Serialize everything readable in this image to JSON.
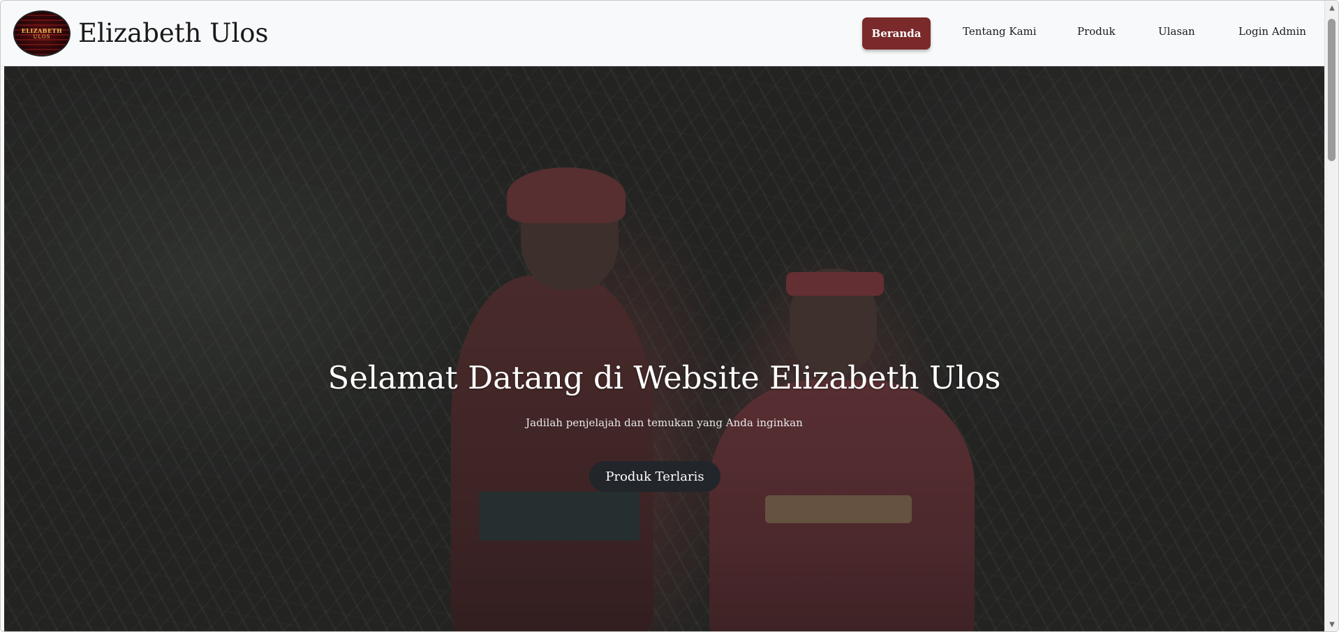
{
  "brand": {
    "name": "Elizabeth Ulos",
    "logo_text_line1": "ELIZABETH",
    "logo_text_line2": "ULOS"
  },
  "nav": {
    "items": [
      {
        "label": "Beranda",
        "active": true
      },
      {
        "label": "Tentang Kami",
        "active": false
      },
      {
        "label": "Produk",
        "active": false
      },
      {
        "label": "Ulasan",
        "active": false
      },
      {
        "label": "Login Admin",
        "active": false
      }
    ]
  },
  "hero": {
    "title": "Selamat Datang di Website Elizabeth Ulos",
    "subtitle": "Jadilah penjelajah dan temukan yang Anda inginkan",
    "button_label": "Produk Terlaris"
  },
  "colors": {
    "accent": "#7a2a2a",
    "button_dark": "#22252a",
    "navbar_bg": "#f8f9fa"
  }
}
